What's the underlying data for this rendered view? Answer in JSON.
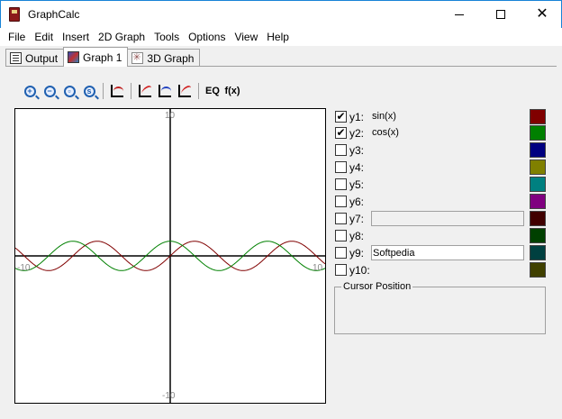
{
  "window": {
    "title": "GraphCalc"
  },
  "menu": [
    "File",
    "Edit",
    "Insert",
    "2D Graph",
    "Tools",
    "Options",
    "View",
    "Help"
  ],
  "tabs": [
    {
      "label": "Output",
      "icon": "output-icon",
      "active": false
    },
    {
      "label": "Graph 1",
      "icon": "graph-icon",
      "active": true
    },
    {
      "label": "3D Graph",
      "icon": "graph-3d-icon",
      "active": false
    }
  ],
  "toolbar": {
    "eq_label": "EQ",
    "fx_label": "f(x)"
  },
  "graph": {
    "y_max_label": "10",
    "y_min_label": "-10",
    "x_min_label": "-10",
    "x_max_label": "10",
    "x_range": [
      -10,
      10
    ],
    "y_range": [
      -10,
      10
    ],
    "series": [
      {
        "expr": "sin(x)",
        "color": "#800000"
      },
      {
        "expr": "cos(x)",
        "color": "#008000"
      }
    ]
  },
  "functions": [
    {
      "name": "y1:",
      "expr": "sin(x)",
      "checked": true,
      "color": "#800000"
    },
    {
      "name": "y2:",
      "expr": "cos(x)",
      "checked": true,
      "color": "#008000"
    },
    {
      "name": "y3:",
      "expr": "",
      "checked": false,
      "color": "#000080"
    },
    {
      "name": "y4:",
      "expr": "",
      "checked": false,
      "color": "#808000"
    },
    {
      "name": "y5:",
      "expr": "",
      "checked": false,
      "color": "#008080"
    },
    {
      "name": "y6:",
      "expr": "",
      "checked": false,
      "color": "#800080"
    },
    {
      "name": "y7:",
      "expr": "",
      "checked": false,
      "color": "#400000"
    },
    {
      "name": "y8:",
      "expr": "",
      "checked": false,
      "color": "#004000"
    },
    {
      "name": "y9:",
      "expr": "Softpedia",
      "checked": false,
      "color": "#004040"
    },
    {
      "name": "y10:",
      "expr": "",
      "checked": false,
      "color": "#404000"
    }
  ],
  "cursor_group": {
    "label": "Cursor Position"
  }
}
